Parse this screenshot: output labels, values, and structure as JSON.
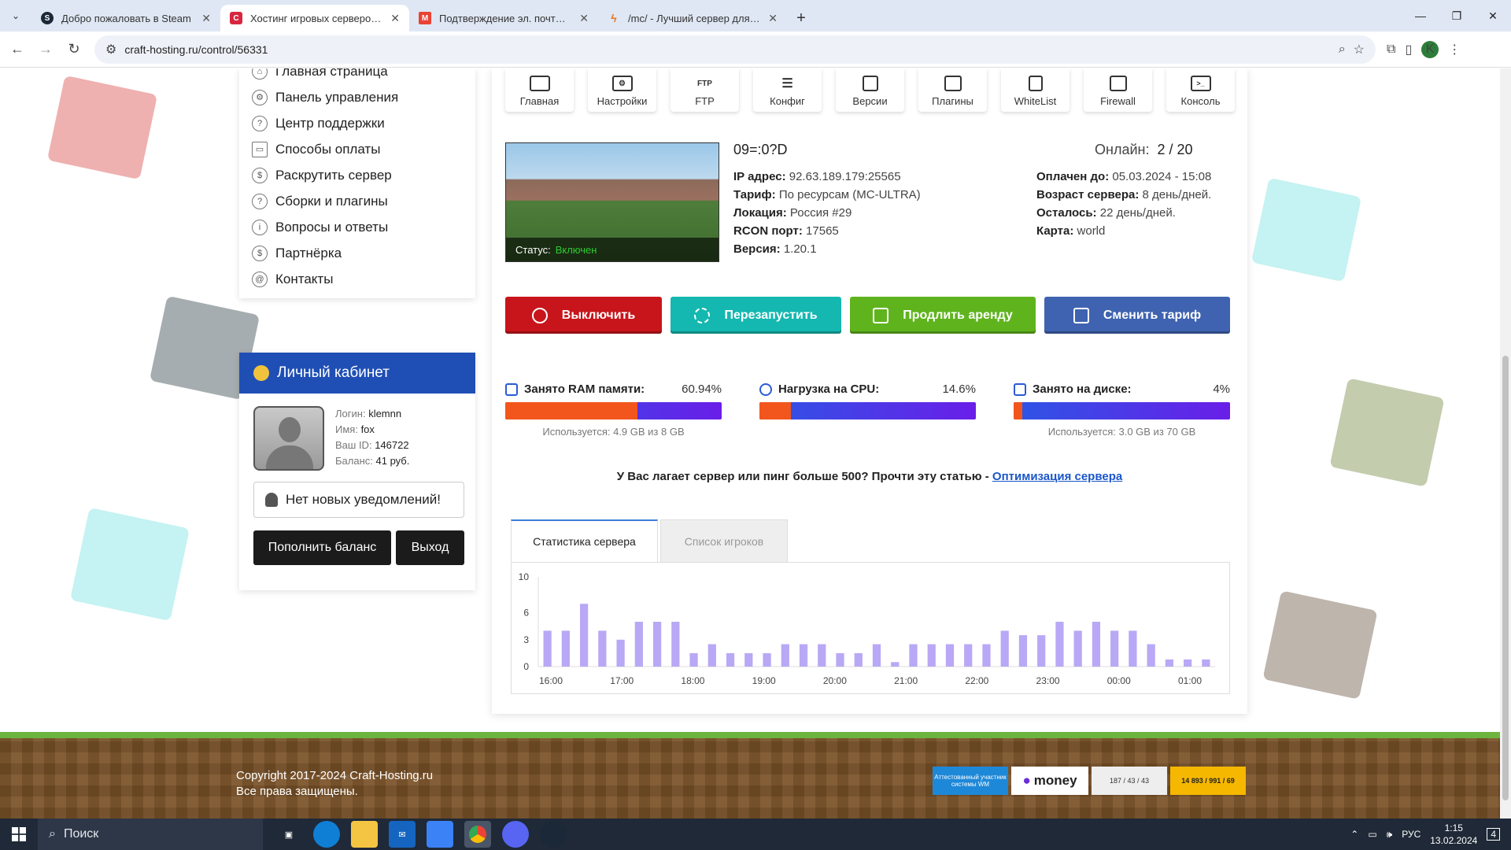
{
  "browser": {
    "tabs": [
      {
        "title": "Добро пожаловать в Steam",
        "icon": "steam-icon",
        "active": false
      },
      {
        "title": "Хостинг игровых серверов Mi",
        "icon": "craft-hosting-icon",
        "active": true
      },
      {
        "title": "Подтверждение эл. почты для",
        "icon": "gmail-icon",
        "active": false
      },
      {
        "title": "/mc/ - Лучший сервер для mc",
        "icon": "bolt-icon",
        "active": false
      }
    ],
    "url": "craft-hosting.ru/control/56331",
    "profile_initial": "K"
  },
  "sidebar_menu": {
    "items": [
      {
        "label": "Главная страница",
        "icon": "home-icon"
      },
      {
        "label": "Панель управления",
        "icon": "gear-icon"
      },
      {
        "label": "Центр поддержки",
        "icon": "help-icon"
      },
      {
        "label": "Способы оплаты",
        "icon": "card-icon"
      },
      {
        "label": "Раскрутить сервер",
        "icon": "dollar-icon"
      },
      {
        "label": "Сборки и плагины",
        "icon": "help-icon"
      },
      {
        "label": "Вопросы и ответы",
        "icon": "info-icon"
      },
      {
        "label": "Партнёрка",
        "icon": "dollar-icon"
      },
      {
        "label": "Контакты",
        "icon": "at-icon"
      }
    ]
  },
  "cabinet": {
    "title": "Личный кабинет",
    "login_label": "Логин:",
    "login": "klemnn",
    "name_label": "Имя:",
    "name": "fox",
    "id_label": "Ваш ID:",
    "id": "146722",
    "balance_label": "Баланс:",
    "balance": "41 руб.",
    "notification": "Нет новых уведомлений!",
    "topup_button": "Пополнить баланс",
    "logout_button": "Выход"
  },
  "toolbar": {
    "items": [
      {
        "label": "Главная",
        "icon": "monitor-icon"
      },
      {
        "label": "Настройки",
        "icon": "settings-icon"
      },
      {
        "label": "FTP",
        "icon": "ftp-icon"
      },
      {
        "label": "Конфиг",
        "icon": "sliders-icon"
      },
      {
        "label": "Версии",
        "icon": "copy-icon"
      },
      {
        "label": "Плагины",
        "icon": "boxes-icon"
      },
      {
        "label": "WhiteList",
        "icon": "document-icon"
      },
      {
        "label": "Firewall",
        "icon": "layers-icon"
      },
      {
        "label": "Консоль",
        "icon": "terminal-icon"
      }
    ]
  },
  "server": {
    "name": "09=:0?D",
    "online_label": "Онлайн:",
    "online": "2 / 20",
    "status_label": "Статус:",
    "status": "Включен",
    "left_fields": [
      {
        "key": "IP адрес:",
        "value": "92.63.189.179:25565"
      },
      {
        "key": "Тариф:",
        "value": "По ресурсам (MC-ULTRA)"
      },
      {
        "key": "Локация:",
        "value": "Россия #29"
      },
      {
        "key": "RCON порт:",
        "value": "17565"
      },
      {
        "key": "Версия:",
        "value": "1.20.1"
      }
    ],
    "right_fields": [
      {
        "key": "Оплачен до:",
        "value": "05.03.2024 - 15:08"
      },
      {
        "key": "Возраст сервера:",
        "value": "8 день/дней."
      },
      {
        "key": "Осталось:",
        "value": "22 день/дней."
      },
      {
        "key": "Карта:",
        "value": "world"
      }
    ]
  },
  "actions": {
    "stop": {
      "label": "Выключить",
      "color": "#c8151b"
    },
    "restart": {
      "label": "Перезапустить",
      "color": "#14b8b0"
    },
    "extend": {
      "label": "Продлить аренду",
      "color": "#5fb41e"
    },
    "change_plan": {
      "label": "Сменить тариф",
      "color": "#3f63b0"
    }
  },
  "resources": [
    {
      "label": "Занято RAM памяти:",
      "percent_text": "60.94%",
      "fraction": 0.6094,
      "usage": "Используется: 4.9 GB из 8 GB",
      "icon": "ram-icon"
    },
    {
      "label": "Нагрузка на CPU:",
      "percent_text": "14.6%",
      "fraction": 0.146,
      "usage": "",
      "icon": "cpu-icon"
    },
    {
      "label": "Занято на диске:",
      "percent_text": "4%",
      "fraction": 0.04,
      "usage": "Используется: 3.0 GB из 70 GB",
      "icon": "disk-icon"
    }
  ],
  "lag_note": {
    "text": "У Вас лагает сервер или пинг больше 500? Прочти эту статью - ",
    "link": "Оптимизация сервера"
  },
  "stats_tabs": {
    "active": "Статистика сервера",
    "inactive": "Список игроков"
  },
  "chart_data": {
    "type": "bar",
    "title": "",
    "xlabel": "",
    "ylabel": "",
    "ylim": [
      0,
      10
    ],
    "yticks": [
      0,
      3,
      6,
      10
    ],
    "xticks": [
      "16:00",
      "17:00",
      "18:00",
      "19:00",
      "20:00",
      "21:00",
      "22:00",
      "23:00",
      "00:00",
      "01:00"
    ],
    "values": [
      4,
      4,
      7,
      4,
      3,
      5,
      5,
      5,
      1.5,
      2.5,
      1.5,
      1.5,
      1.5,
      2.5,
      2.5,
      2.5,
      1.5,
      1.5,
      2.5,
      0.5,
      2.5,
      2.5,
      2.5,
      2.5,
      2.5,
      4,
      3.5,
      3.5,
      5,
      4,
      5,
      4,
      4,
      2.5,
      0.8,
      0.8,
      0.8
    ],
    "color": "#b9a8f5"
  },
  "footer": {
    "copyright": "Copyright 2017-2024 Craft-Hosting.ru",
    "rights": "Все права защищены.",
    "badge_wm": "Аттестованный участник системы WM",
    "badge_money": "money",
    "badge_counter": "187 / 43 / 43",
    "badge_counter2": "14 893 / 991 / 69"
  },
  "taskbar": {
    "search_placeholder": "Поиск",
    "lang": "РУС",
    "time": "1:15",
    "date": "13.02.2024",
    "notif_count": "4"
  }
}
